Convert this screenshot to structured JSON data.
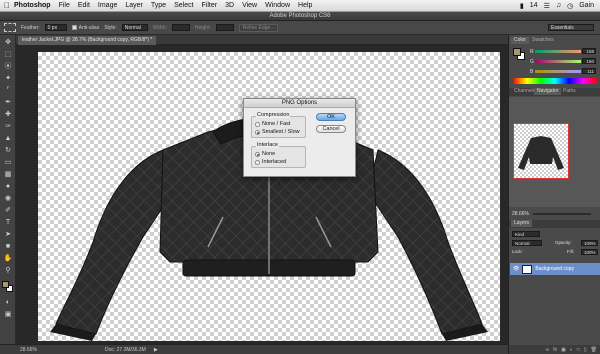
{
  "menubar": {
    "app_name": "Photoshop",
    "items": [
      "File",
      "Edit",
      "Image",
      "Layer",
      "Type",
      "Select",
      "Filter",
      "3D",
      "View",
      "Window",
      "Help"
    ],
    "battery": "14",
    "user": "Gain"
  },
  "window": {
    "title": "Adobe Photoshop CS6"
  },
  "options": {
    "feather_label": "Feather:",
    "feather_value": "0 px",
    "antialias_label": "Anti-alias",
    "style_label": "Style:",
    "style_value": "Normal",
    "width_label": "Width:",
    "height_label": "Height:",
    "refine_edge": "Refine Edge...",
    "workspace": "Essentials"
  },
  "document": {
    "tab_title": "leather Jacket.JPG @ 28.7% (Background copy, RGB/8*) *",
    "zoom": "28.66%",
    "doc_size": "Doc: 27.3M/36.3M"
  },
  "dialog": {
    "title": "PNG Options",
    "compression_label": "Compression",
    "opt_none_fast": "None / Fast",
    "opt_smallest_slow": "Smallest / Slow",
    "interlace_label": "Interlace",
    "opt_none": "None",
    "opt_interlaced": "Interlaced",
    "ok": "OK",
    "cancel": "Cancel"
  },
  "panels": {
    "color_tab": "Color",
    "swatches_tab": "Swatches",
    "channels_tab": "Channels",
    "navigator_tab": "Navigator",
    "paths_tab": "Paths",
    "rgb_labels": [
      "R",
      "G",
      "B"
    ],
    "rgb_values": [
      "168",
      "150",
      "111"
    ],
    "nav_zoom": "28.66%",
    "layers_tab": "Layers",
    "kind": "Kind",
    "blend_mode": "Normal",
    "opacity_label": "Opacity:",
    "opacity_value": "100%",
    "lock_label": "Lock:",
    "fill_label": "Fill:",
    "fill_value": "100%",
    "layer_name": "Background copy"
  },
  "colors": {
    "accent": "#6aa6e6",
    "layer_selected": "#6d8fc9"
  }
}
